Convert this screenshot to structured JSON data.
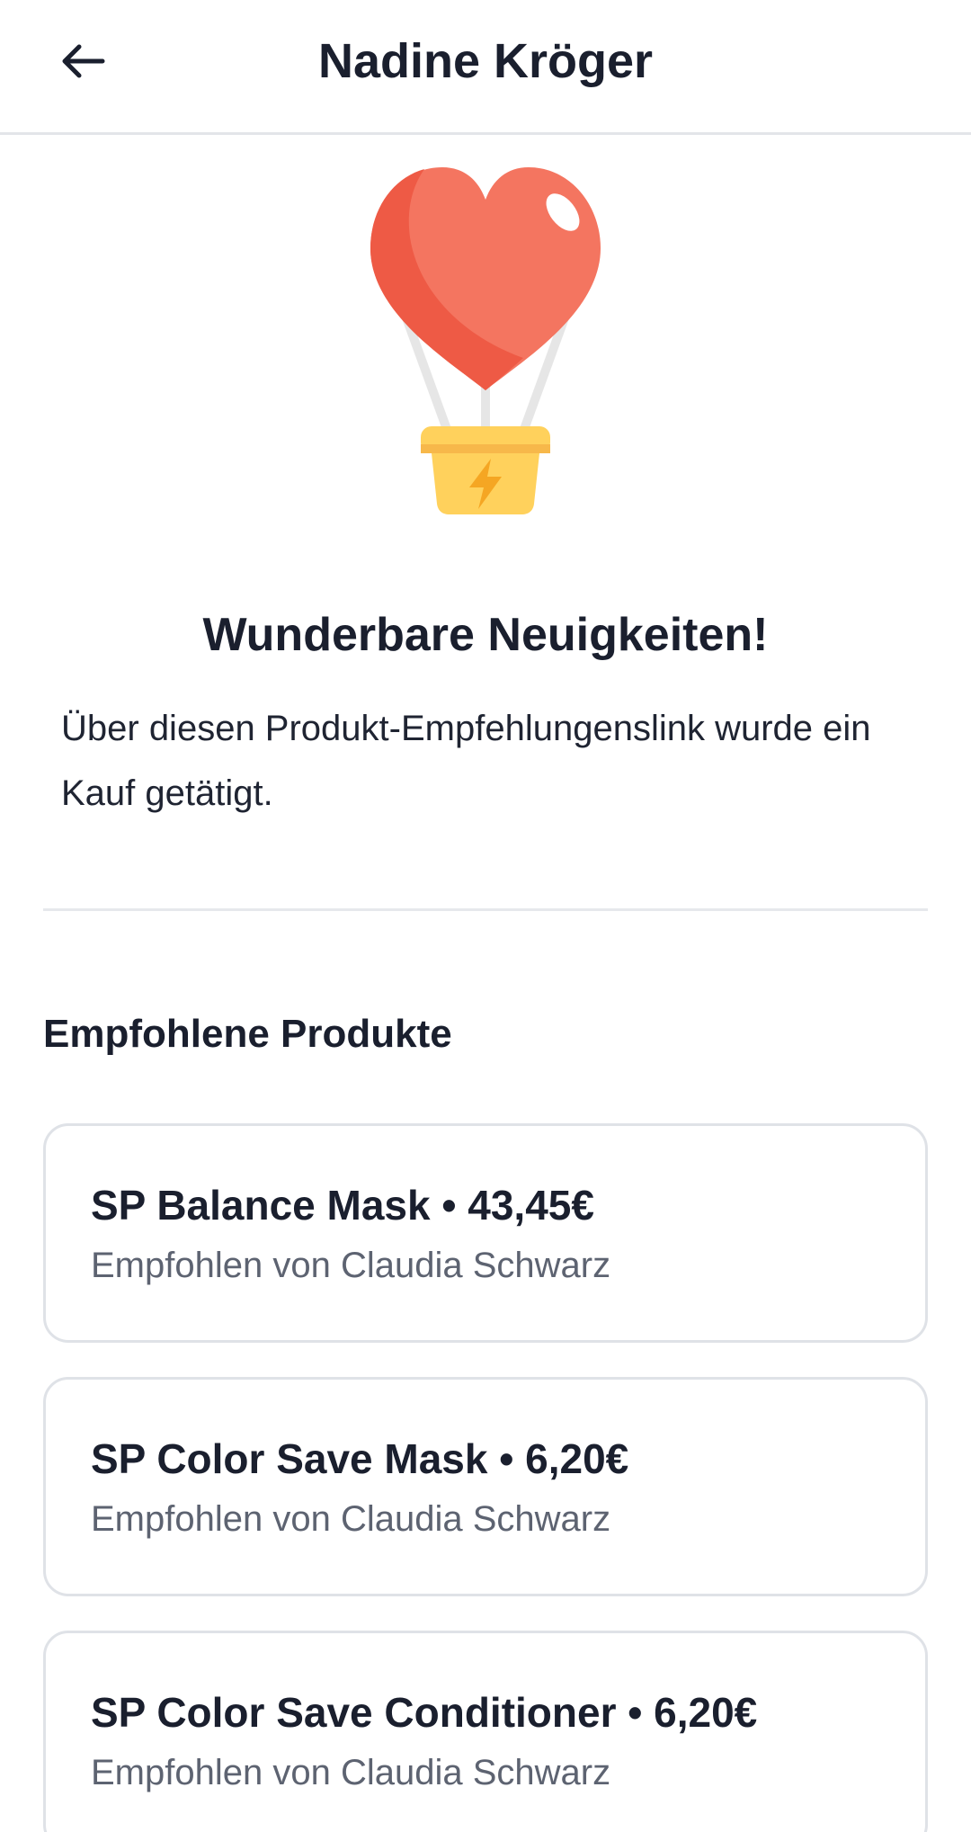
{
  "header": {
    "title": "Nadine Kröger",
    "back_icon": "arrow-left-icon"
  },
  "illustration": {
    "icon": "heart-hot-air-balloon-icon",
    "colors": {
      "heart": "#F47560",
      "heart_shadow": "#EE5A45",
      "basket": "#FFD15C",
      "bolt": "#F5A623"
    }
  },
  "announcement": {
    "headline": "Wunderbare Neuigkeiten!",
    "message": "Über diesen Produkt-Empfehlungenslink wurde ein Kauf getätigt."
  },
  "products": {
    "section_title": "Empfohlene Produkte",
    "items": [
      {
        "name": "SP Balance Mask • 43,45€",
        "recommended_by": "Empfohlen von Claudia Schwarz"
      },
      {
        "name": "SP Color Save Mask • 6,20€",
        "recommended_by": "Empfohlen von Claudia Schwarz"
      },
      {
        "name": "SP Color Save Conditioner • 6,20€",
        "recommended_by": "Empfohlen von Claudia Schwarz"
      }
    ]
  }
}
